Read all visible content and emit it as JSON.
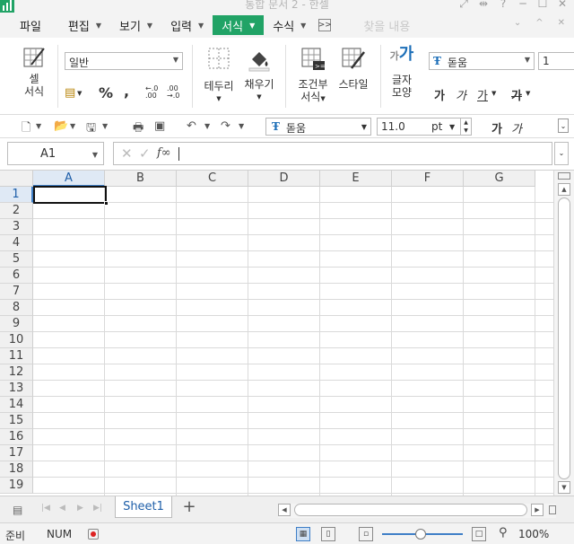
{
  "window": {
    "title": "통합 문서 2 - 한셀",
    "controls": [
      "⤢",
      "⇹",
      "?",
      "─",
      "☐",
      "✕"
    ]
  },
  "menu": {
    "items": [
      {
        "label": "파일",
        "caret": false,
        "active": false
      },
      {
        "label": "편집",
        "caret": true,
        "active": false
      },
      {
        "label": "보기",
        "caret": true,
        "active": false
      },
      {
        "label": "입력",
        "caret": true,
        "active": false
      },
      {
        "label": "서식",
        "caret": true,
        "active": true
      },
      {
        "label": "수식",
        "caret": true,
        "active": false
      }
    ],
    "more": ">>",
    "search_placeholder": "찾을 내용"
  },
  "ribbon": {
    "cell_format": {
      "line1": "셀",
      "line2": "서식"
    },
    "number_format": "일반",
    "currency": "₩",
    "percent": "%",
    "comma": ",",
    "dec_inc": "←.0\n.00",
    "dec_dec": ".00\n→.0",
    "border": "테두리",
    "fill": "채우기",
    "cond_format": {
      "line1": "조건부",
      "line2": "서식"
    },
    "style": "스타일",
    "char_shape": {
      "line1": "글자",
      "line2": "모양"
    },
    "font_name": "돋움",
    "font_size_partial": "1",
    "text_styles": [
      "가",
      "가",
      "가",
      "가"
    ]
  },
  "qat": {
    "font_name": "돋움",
    "font_size": "11.0",
    "unit": "pt",
    "text_styles": [
      "가",
      "가"
    ]
  },
  "formula": {
    "name_box": "A1",
    "cancel": "✕",
    "enter": "✓",
    "fx": "f∞",
    "value": ""
  },
  "grid": {
    "columns": [
      "A",
      "B",
      "C",
      "D",
      "E",
      "F",
      "G"
    ],
    "rows": [
      "1",
      "2",
      "3",
      "4",
      "5",
      "6",
      "7",
      "8",
      "9",
      "10",
      "11",
      "12",
      "13",
      "14",
      "15",
      "16",
      "17",
      "18",
      "19"
    ],
    "selected_cell": "A1"
  },
  "sheets": {
    "tabs": [
      "Sheet1"
    ],
    "active": "Sheet1",
    "add": "+"
  },
  "status": {
    "ready": "준비",
    "num": "NUM",
    "zoom": "100%"
  },
  "colors": {
    "accent": "#21a366",
    "selection": "#3f7fc7"
  }
}
